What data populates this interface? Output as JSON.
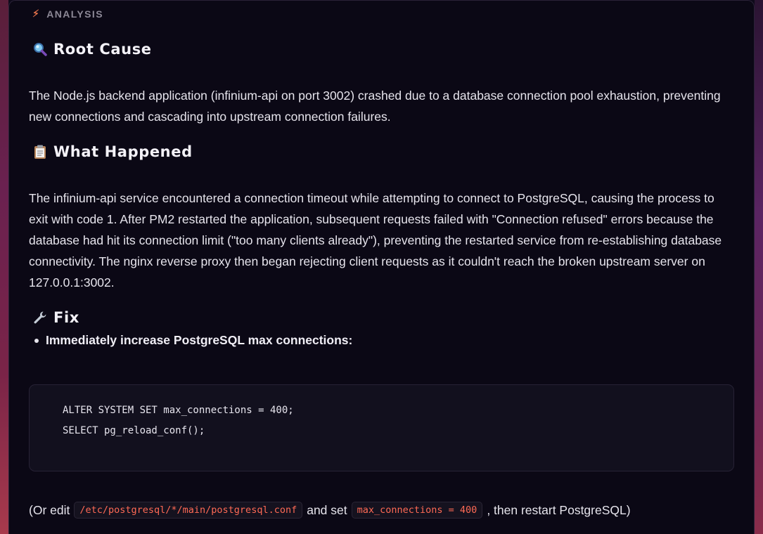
{
  "header": {
    "label": "ANALYSIS",
    "icon": "lightning-icon"
  },
  "root_cause": {
    "title": "Root Cause",
    "icon": "magnifier-icon",
    "text": "The Node.js backend application (infinium-api on port 3002) crashed due to a database connection pool exhaustion, preventing new connections and cascading into upstream connection failures."
  },
  "what_happened": {
    "title": "What Happened",
    "icon": "clipboard-icon",
    "text": "The infinium-api service encountered a connection timeout while attempting to connect to PostgreSQL, causing the process to exit with code 1. After PM2 restarted the application, subsequent requests failed with \"Connection refused\" errors because the database had hit its connection limit (\"too many clients already\"), preventing the restarted service from re-establishing database connectivity. The nginx reverse proxy then began rejecting client requests as it couldn't reach the broken upstream server on 127.0.0.1:3002."
  },
  "fix": {
    "title": "Fix",
    "icon": "wrench-icon",
    "bullet": "Immediately increase PostgreSQL max connections:",
    "code": [
      "ALTER SYSTEM SET max_connections = 400;",
      "SELECT pg_reload_conf();"
    ],
    "note_prefix": "(Or edit",
    "note_path": "/etc/postgresql/*/main/postgresql.conf",
    "note_mid": "and set",
    "note_setting": "max_connections = 400",
    "note_suffix": ", then restart PostgreSQL)"
  },
  "colors": {
    "background": "#0b0815",
    "accent": "#e0704a",
    "inline_code": "#ff6a55"
  }
}
